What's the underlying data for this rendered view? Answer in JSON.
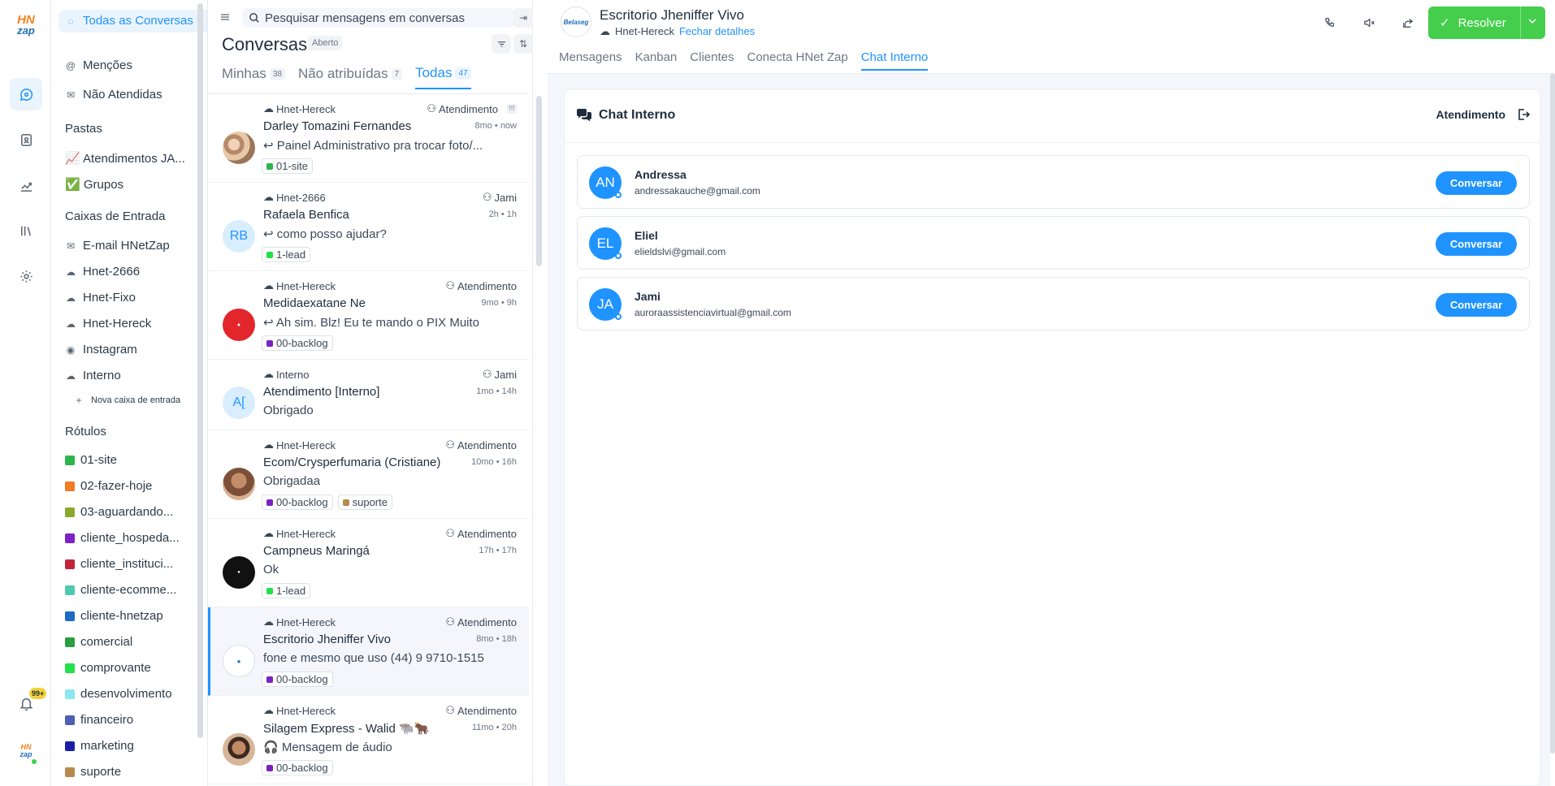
{
  "rail": {
    "logo_top": "HN",
    "logo_bottom": "zap",
    "logo_small_top": "HN",
    "logo_small_bottom": "zap",
    "notif_badge": "99+"
  },
  "sidebar": {
    "all_conversations": "Todas as Conversas",
    "mentions": "Menções",
    "unattended": "Não Atendidas",
    "folders_heading": "Pastas",
    "folders": [
      "📈 Atendimentos JA...",
      "✅ Grupos"
    ],
    "inboxes_heading": "Caixas de Entrada",
    "inboxes": [
      "E-mail HNetZap",
      "Hnet-2666",
      "Hnet-Fixo",
      "Hnet-Hereck",
      "Instagram",
      "Interno"
    ],
    "new_inbox": "Nova caixa de entrada",
    "labels_heading": "Rótulos",
    "labels": [
      {
        "name": "01-site",
        "color": "#2bb54a"
      },
      {
        "name": "02-fazer-hoje",
        "color": "#f27b25"
      },
      {
        "name": "03-aguardando...",
        "color": "#8aa82b"
      },
      {
        "name": "cliente_hospeda...",
        "color": "#7b22c4"
      },
      {
        "name": "cliente_instituci...",
        "color": "#c4233a"
      },
      {
        "name": "cliente-ecomme...",
        "color": "#4fc9b0"
      },
      {
        "name": "cliente-hnetzap",
        "color": "#1c6bc4"
      },
      {
        "name": "comercial",
        "color": "#2b9e3f"
      },
      {
        "name": "comprovante",
        "color": "#22e04b"
      },
      {
        "name": "desenvolvimento",
        "color": "#8ae8ee"
      },
      {
        "name": "financeiro",
        "color": "#4d5fb3"
      },
      {
        "name": "marketing",
        "color": "#1b1fa8"
      },
      {
        "name": "suporte",
        "color": "#b58a4c"
      }
    ]
  },
  "conversations": {
    "search_placeholder": "Pesquisar mensagens em conversas",
    "title": "Conversas",
    "status": "Aberto",
    "tabs": [
      {
        "label": "Minhas",
        "count": "38"
      },
      {
        "label": "Não atribuídas",
        "count": "7"
      },
      {
        "label": "Todas",
        "count": "47"
      }
    ],
    "items": [
      {
        "inbox": "Hnet-Hereck",
        "assignee": "Atendimento",
        "name": "Darley Tomazini Fernandes",
        "time": "8mo • now",
        "message": "↩ Painel Administrativo pra trocar foto/...",
        "labels": [
          {
            "name": "01-site",
            "color": "#2bb54a"
          }
        ]
      },
      {
        "inbox": "Hnet-2666",
        "assignee": "Jami",
        "name": "Rafaela Benfica",
        "time": "2h • 1h",
        "message": "↩ como posso ajudar?",
        "initials": "RB",
        "labels": [
          {
            "name": "1-lead",
            "color": "#22e04b"
          }
        ]
      },
      {
        "inbox": "Hnet-Hereck",
        "assignee": "Atendimento",
        "name": "Medidaexatane Ne",
        "time": "9mo • 9h",
        "message": "↩ Ah sim. Blz! Eu te mando o PIX Muito ...",
        "labels": [
          {
            "name": "00-backlog",
            "color": "#7b22c4"
          }
        ]
      },
      {
        "inbox": "Interno",
        "assignee": "Jami",
        "name": "Atendimento [Interno]",
        "time": "1mo • 14h",
        "message": "Obrigado",
        "initials": "A[",
        "labels": []
      },
      {
        "inbox": "Hnet-Hereck",
        "assignee": "Atendimento",
        "name": "Ecom/Crysperfumaria (Cristiane)",
        "time": "10mo • 16h",
        "message": "Obrigadaa",
        "labels": [
          {
            "name": "00-backlog",
            "color": "#7b22c4"
          },
          {
            "name": "suporte",
            "color": "#b58a4c"
          }
        ]
      },
      {
        "inbox": "Hnet-Hereck",
        "assignee": "Atendimento",
        "name": "Campneus Maringá",
        "time": "17h • 17h",
        "message": "Ok",
        "labels": [
          {
            "name": "1-lead",
            "color": "#22e04b"
          }
        ]
      },
      {
        "inbox": "Hnet-Hereck",
        "assignee": "Atendimento",
        "name": "Escritorio Jheniffer Vivo",
        "time": "8mo • 18h",
        "message": "fone e mesmo que uso (44) 9 9710-1515",
        "labels": [
          {
            "name": "00-backlog",
            "color": "#7b22c4"
          }
        ]
      },
      {
        "inbox": "Hnet-Hereck",
        "assignee": "Atendimento",
        "name": "Silagem Express - Walid 🐃🐂",
        "time": "11mo • 20h",
        "message": "🎧 Mensagem de áudio",
        "labels": [
          {
            "name": "00-backlog",
            "color": "#7b22c4"
          }
        ]
      }
    ]
  },
  "header": {
    "contact_name": "Escritorio Jheniffer Vivo",
    "inbox": "Hnet-Hereck",
    "close_details": "Fechar detalhes",
    "resolve": "Resolver",
    "avatar_text": "Belaseg",
    "tabs": [
      "Mensagens",
      "Kanban",
      "Clientes",
      "Conecta HNet Zap",
      "Chat Interno"
    ],
    "active_tab": "Chat Interno"
  },
  "internal_chat": {
    "title": "Chat Interno",
    "team": "Atendimento",
    "members": [
      {
        "initials": "AN",
        "name": "Andressa",
        "email": "andressakauche@gmail.com",
        "button": "Conversar"
      },
      {
        "initials": "EL",
        "name": "Eliel",
        "email": "elieldslvi@gmail.com",
        "button": "Conversar"
      },
      {
        "initials": "JA",
        "name": "Jami",
        "email": "auroraassistenciavirtual@gmail.com",
        "button": "Conversar"
      }
    ]
  },
  "colors": {
    "accent": "#1f93ff",
    "resolve": "#44ce4b"
  }
}
